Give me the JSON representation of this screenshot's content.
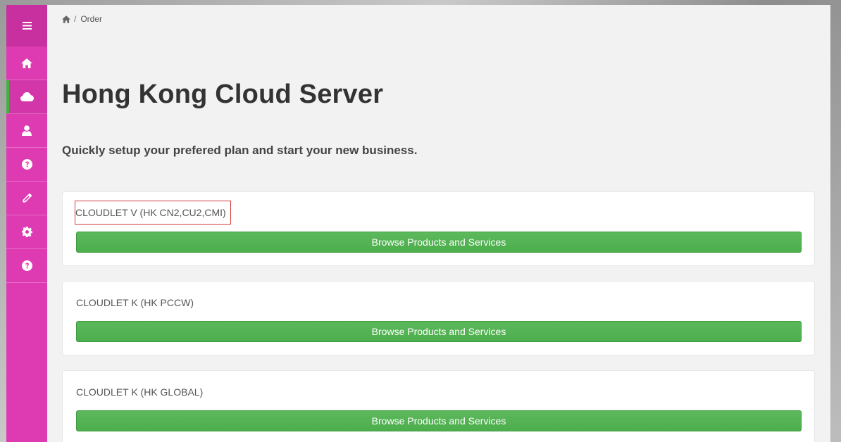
{
  "sidebar": {
    "menu_icon": "hamburger-icon",
    "items": [
      {
        "icon": "home-icon",
        "active": false
      },
      {
        "icon": "cloud-icon",
        "active": true
      },
      {
        "icon": "user-icon",
        "active": false
      },
      {
        "icon": "question-circle-icon",
        "active": false
      },
      {
        "icon": "pencil-icon",
        "active": false
      },
      {
        "icon": "gear-icon",
        "active": false
      },
      {
        "icon": "question-circle-icon",
        "active": false
      }
    ],
    "colors": {
      "background": "#de3bb3",
      "active_indicator": "#3fb53a"
    }
  },
  "breadcrumb": {
    "home_icon": "home-icon",
    "separator": "/",
    "current": "Order"
  },
  "page": {
    "title": "Hong Kong Cloud Server",
    "subtitle": "Quickly setup your prefered plan and start your new business."
  },
  "products": [
    {
      "name": "CLOUDLET V (HK CN2,CU2,CMI)",
      "button_label": "Browse Products and Services",
      "highlighted": true
    },
    {
      "name": "CLOUDLET K (HK PCCW)",
      "button_label": "Browse Products and Services",
      "highlighted": false
    },
    {
      "name": "CLOUDLET K (HK GLOBAL)",
      "button_label": "Browse Products and Services",
      "highlighted": false
    }
  ],
  "colors": {
    "button_green": "#5cb85c",
    "highlight_border": "#d33a3a"
  }
}
